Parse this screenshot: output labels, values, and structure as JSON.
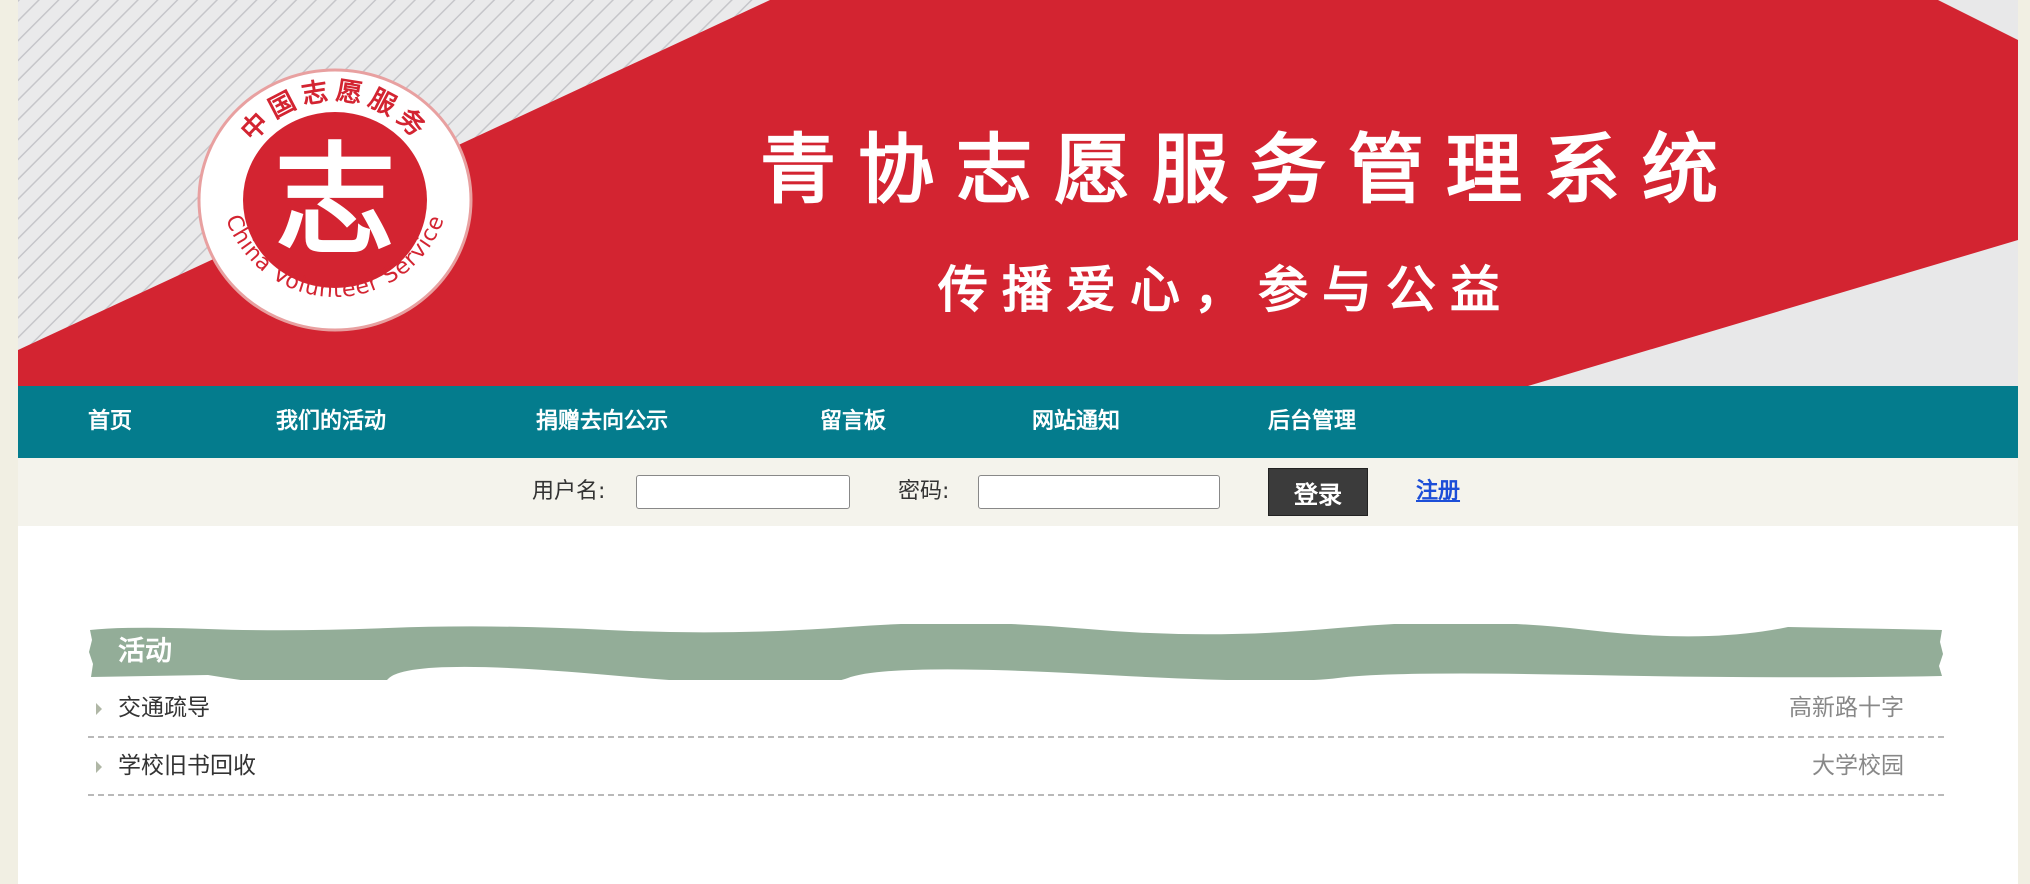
{
  "banner": {
    "title": "青协志愿服务管理系统",
    "slogan": "传播爱心，参与公益",
    "logo_top_text": "中国志愿服务",
    "logo_center_text": "志",
    "logo_bottom_text": "China Volunteer Service",
    "colors": {
      "red": "#d32431",
      "stripe_bg": "#e9e9ea",
      "stripe_line": "#c9c9cc"
    }
  },
  "nav": {
    "items": [
      {
        "label": "首页"
      },
      {
        "label": "我们的活动"
      },
      {
        "label": "捐赠去向公示"
      },
      {
        "label": "留言板"
      },
      {
        "label": "网站通知"
      },
      {
        "label": "后台管理"
      }
    ],
    "color": "#047c8d"
  },
  "login": {
    "username_label": "用户名:",
    "username_value": "",
    "password_label": "密码:",
    "password_value": "",
    "login_button": "登录",
    "register_link": "注册"
  },
  "activities": {
    "header": "活动",
    "header_color": "#93ad98",
    "items": [
      {
        "title": "交通疏导",
        "location": "高新路十字"
      },
      {
        "title": "学校旧书回收",
        "location": "大学校园"
      }
    ]
  }
}
